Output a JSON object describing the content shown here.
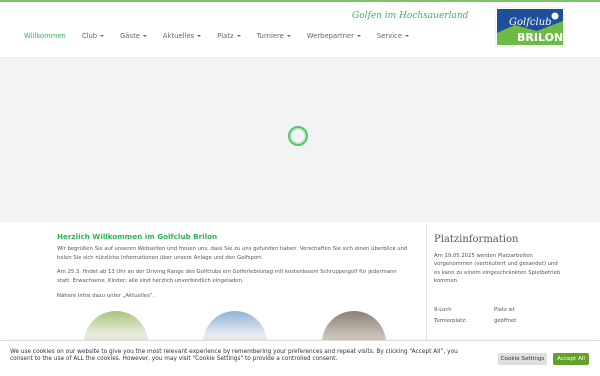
{
  "header": {
    "tagline": "Golfen im Hochsauerland",
    "logo_text_top": "Golfclub",
    "logo_text_bottom": "BRILON"
  },
  "nav": {
    "items": [
      {
        "label": "Willkommen",
        "active": true,
        "dropdown": false
      },
      {
        "label": "Club",
        "active": false,
        "dropdown": true
      },
      {
        "label": "Gäste",
        "active": false,
        "dropdown": true
      },
      {
        "label": "Aktuelles",
        "active": false,
        "dropdown": true
      },
      {
        "label": "Platz",
        "active": false,
        "dropdown": true
      },
      {
        "label": "Turniere",
        "active": false,
        "dropdown": true
      },
      {
        "label": "Werbepartner",
        "active": false,
        "dropdown": true
      },
      {
        "label": "Service",
        "active": false,
        "dropdown": true
      }
    ]
  },
  "main": {
    "title": "Herzlich Willkommen im Golfclub Brilon",
    "paragraphs": [
      "Wir begrüßen Sie auf unseren Webseiten und freuen uns, dass Sie zu uns gefunden haben. Verschaffen Sie sich einen überblick und holen Sie sich nützliche Informationen über unsere Anlage und den Golfsport.",
      "Am 25.3. findet ab 13 Uhr an der Driving Range des Golfclubs ein Golferlebnistag mit kostenlosem Schruppergolf für jedermann statt. Erwachsene, Kinder; alle sind herzlich unverbindlich eingeladen.",
      "Nähere Infos dazu unter „Aktuelles“."
    ]
  },
  "sidebar": {
    "title": "Platzinformation",
    "text": "Am 19.05.2025 werden Platzarbeiten vorgenommen (vertikutiert und gesandet) und es kann zu einem eingeschränkten Spielbetrieb kommen.",
    "rows": [
      {
        "label": "9-Loch",
        "value": "Platz ist"
      },
      {
        "label": "Turnierplatz:",
        "value": "geöffnet"
      }
    ]
  },
  "cookie": {
    "text": "We use cookies on our website to give you the most relevant experience by remembering your preferences and repeat visits. By clicking “Accept All”, you consent to the use of ALL the cookies. However, you may visit \"Cookie Settings\" to provide a controlled consent.",
    "settings_label": "Cookie Settings",
    "accept_label": "Accept All"
  },
  "colors": {
    "accent": "#2fb35a",
    "accept_button": "#61a229",
    "logo_blue": "#1f4f9a"
  },
  "icons": {
    "loader": "loading-spinner-icon",
    "dropdown": "caret-down-icon"
  }
}
